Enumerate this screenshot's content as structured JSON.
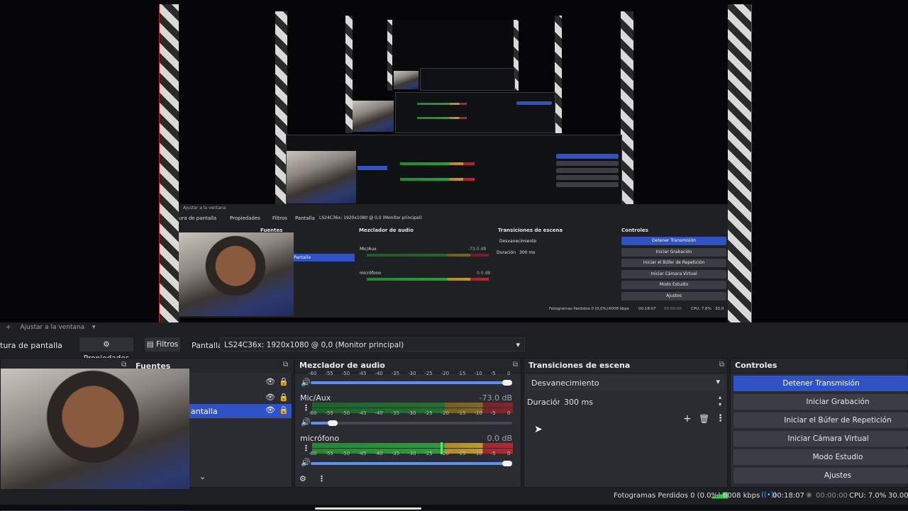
{
  "preview": {
    "inner_label_fit": "Ajustar a la ventana",
    "inner_props": "Propiedades",
    "inner_filters": "Filtros",
    "inner_source": "Pantalla",
    "inner_source_value": "LS24C36x: 1920x1080 @ 0,0 (Monitor principal)",
    "inner_capture": "ura de pantalla",
    "inner_sources_title": "Fuentes",
    "inner_mixer_title": "Mezclador de audio",
    "inner_transitions_title": "Transiciones de escena",
    "inner_controls_title": "Controles",
    "inner_transition_value": "Desvanecimiento",
    "inner_duration_label": "Duración",
    "inner_duration_value": "300 ms",
    "inner_mic_aux": "Mic/Aux",
    "inner_mic_aux_db": "-73.0 dB",
    "inner_microfono": "micrófono",
    "inner_microfono_db": "0.0 dB",
    "inner_source_item": "Pantalla",
    "inner_controls": [
      "Detener Transmisión",
      "Iniciar Grabación",
      "Iniciar el Búfer de Repetición",
      "Iniciar Cámara Virtual",
      "Modo Estudio",
      "Ajustes"
    ],
    "inner_status": "Fotogramas Perdidos 0 (0,0%)",
    "inner_kbps": "6008 kbps",
    "inner_time": "00:18:07",
    "inner_rec": "00:00:00",
    "inner_cpu": "CPU: 7,6%",
    "inner_fps": "30.0"
  },
  "toolbar": {
    "fit_label": "Ajustar a la ventana",
    "capture_label": "tura de pantalla",
    "properties_label": "Propiedades",
    "filters_label": "Filtros",
    "source_label": "Pantalla",
    "source_value": "LS24C36x: 1920x1080 @ 0,0 (Monitor principal)"
  },
  "sources": {
    "title": "Fuentes",
    "items": [
      "",
      "",
      "antalla"
    ]
  },
  "mixer": {
    "title": "Mezclador de audio",
    "ticks": [
      "-60",
      "-55",
      "-50",
      "-45",
      "-40",
      "-35",
      "-30",
      "-25",
      "-20",
      "-15",
      "-10",
      "-5",
      "0"
    ],
    "top_ticks": [
      "-60",
      "-55",
      "-50",
      "-45",
      "-40",
      "-35",
      "-30",
      "-25",
      "-20",
      "-15",
      "-10",
      "-5",
      "0"
    ],
    "channels": [
      {
        "name": "Mic/Aux",
        "db": "-73.0 dB",
        "level": 0.0
      },
      {
        "name": "micrófono",
        "db": "0.0 dB",
        "level": 0.73
      }
    ]
  },
  "transitions": {
    "title": "Transiciones de escena",
    "selected": "Desvanecimiento",
    "duration_label": "Duración",
    "duration_value": "300 ms"
  },
  "controls": {
    "title": "Controles",
    "buttons": [
      "Detener Transmisión",
      "Iniciar Grabación",
      "Iniciar el Búfer de Repetición",
      "Iniciar Cámara Virtual",
      "Modo Estudio",
      "Ajustes"
    ]
  },
  "status": {
    "dropped": "Fotogramas Perdidos 0 (0.0%)",
    "kbps": "6008 kbps",
    "stream_time": "00:18:07",
    "rec_time": "00:00:00",
    "cpu": "CPU: 7.0%",
    "fps": "30.00"
  },
  "colors": {
    "accent": "#2f52c4",
    "meter_green": "#25a136",
    "meter_yellow": "#c29a24",
    "meter_red": "#c02431"
  }
}
